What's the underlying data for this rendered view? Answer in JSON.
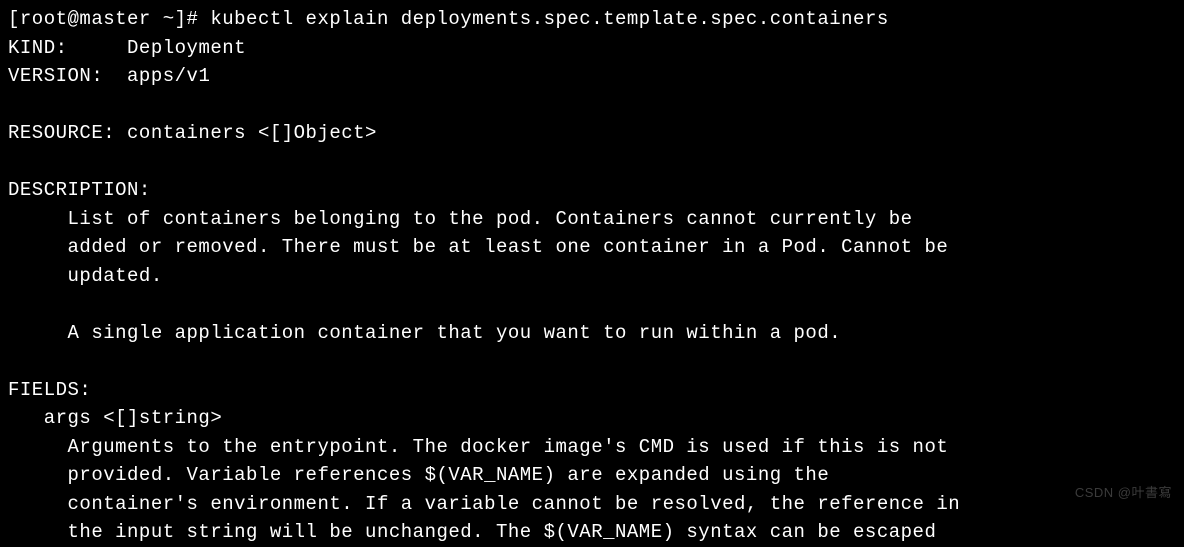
{
  "terminal": {
    "prompt": "[root@master ~]# ",
    "command": "kubectl explain deployments.spec.template.spec.containers",
    "output": {
      "kind_label": "KIND:     ",
      "kind_value": "Deployment",
      "version_label": "VERSION:  ",
      "version_value": "apps/v1",
      "resource_line": "RESOURCE: containers <[]Object>",
      "description_header": "DESCRIPTION:",
      "description_line1": "     List of containers belonging to the pod. Containers cannot currently be",
      "description_line2": "     added or removed. There must be at least one container in a Pod. Cannot be",
      "description_line3": "     updated.",
      "description_line4": "     A single application container that you want to run within a pod.",
      "fields_header": "FIELDS:",
      "field_args": "   args\t<[]string>",
      "args_line1": "     Arguments to the entrypoint. The docker image's CMD is used if this is not",
      "args_line2": "     provided. Variable references $(VAR_NAME) are expanded using the",
      "args_line3": "     container's environment. If a variable cannot be resolved, the reference in",
      "args_line4": "     the input string will be unchanged. The $(VAR_NAME) syntax can be escaped"
    }
  },
  "watermark": "CSDN @叶書寫"
}
